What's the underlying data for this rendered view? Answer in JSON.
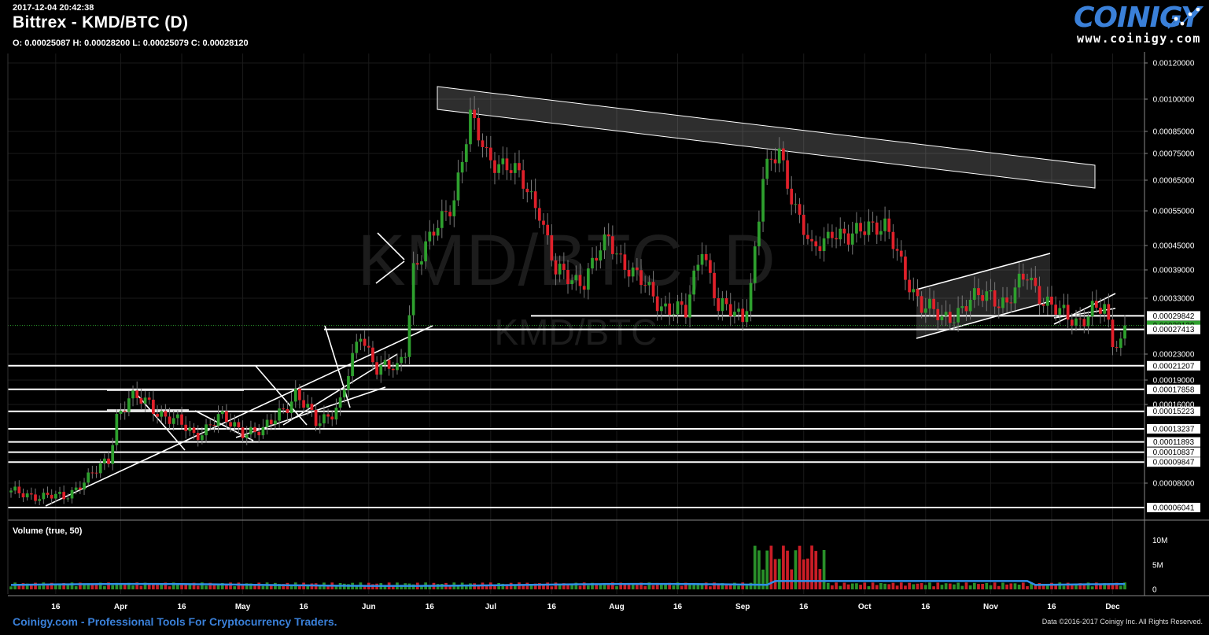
{
  "header": {
    "timestamp": "2017-12-04 20:42:38",
    "title": "Bittrex - KMD/BTC (D)",
    "ohlc": "O: 0.00025087 H: 0.00028200 L: 0.00025079 C: 0.00028120"
  },
  "logo": {
    "word": "COINIGY",
    "url": "www.coinigy.com"
  },
  "watermark": {
    "big": "KMD/BTC, D",
    "small": "KMD/BTC"
  },
  "footer": {
    "left": "Coinigy.com - Professional Tools For Cryptocurrency Traders.",
    "right": "Data ©2016-2017 Coinigy Inc. All Rights Reserved."
  },
  "colors": {
    "up": "#2ea02e",
    "down": "#e0202a",
    "volume_ma": "#2f8fe8",
    "accent": "#3a80d9",
    "last_price_bg": "#2ea02e"
  },
  "chart_data": {
    "type": "candlestick",
    "exchange": "Bittrex",
    "pair": "KMD/BTC",
    "timeframe": "D",
    "price_axis_ticks": [
      "0.00120000",
      "0.00100000",
      "0.00085000",
      "0.00075000",
      "0.00065000",
      "0.00055000",
      "0.00045000",
      "0.00039000",
      "0.00033000",
      "0.00029842",
      "0.00028120",
      "0.00027413",
      "0.00023000",
      "0.00021207",
      "0.00019000",
      "0.00017858",
      "0.00016000",
      "0.00015223",
      "0.00013237",
      "0.00011893",
      "0.00010837",
      "0.00009847",
      "0.00008000",
      "0.00006041"
    ],
    "last_price": "0.00028120",
    "horizontal_levels": [
      0.00029842,
      0.00027413,
      0.00021207,
      0.00017858,
      0.00015223,
      0.00013237,
      0.00011893,
      0.00010837,
      9.847e-05,
      6.041e-05
    ],
    "x_ticks": [
      "16",
      "Apr",
      "16",
      "May",
      "16",
      "Jun",
      "16",
      "Jul",
      "16",
      "Aug",
      "16",
      "Sep",
      "16",
      "Oct",
      "16",
      "Nov",
      "16",
      "Dec"
    ],
    "x_tick_dates": [
      "2017-03-16",
      "2017-04-01",
      "2017-04-16",
      "2017-05-01",
      "2017-05-16",
      "2017-06-01",
      "2017-06-16",
      "2017-07-01",
      "2017-07-16",
      "2017-08-01",
      "2017-08-16",
      "2017-09-01",
      "2017-09-16",
      "2017-10-01",
      "2017-10-16",
      "2017-11-01",
      "2017-11-16",
      "2017-12-01"
    ],
    "start_date": "2017-03-05",
    "end_date": "2017-12-04",
    "series_keypoints": [
      [
        "2017-03-05",
        7.2e-05
      ],
      [
        "2017-03-12",
        7e-05
      ],
      [
        "2017-03-18",
        6.8e-05
      ],
      [
        "2017-03-22",
        8e-05
      ],
      [
        "2017-03-26",
        9e-05
      ],
      [
        "2017-03-29",
        0.0001
      ],
      [
        "2017-03-31",
        0.000148
      ],
      [
        "2017-04-03",
        0.000168
      ],
      [
        "2017-04-08",
        0.00016
      ],
      [
        "2017-04-14",
        0.000142
      ],
      [
        "2017-04-19",
        0.000126
      ],
      [
        "2017-04-25",
        0.000144
      ],
      [
        "2017-05-01",
        0.000132
      ],
      [
        "2017-05-06",
        0.000128
      ],
      [
        "2017-05-10",
        0.000152
      ],
      [
        "2017-05-14",
        0.000172
      ],
      [
        "2017-05-19",
        0.00014
      ],
      [
        "2017-05-25",
        0.00016
      ],
      [
        "2017-05-30",
        0.00027
      ],
      [
        "2017-06-03",
        0.00021
      ],
      [
        "2017-06-08",
        0.000205
      ],
      [
        "2017-06-10",
        0.00024
      ],
      [
        "2017-06-12",
        0.0004
      ],
      [
        "2017-06-16",
        0.00046
      ],
      [
        "2017-06-22",
        0.0006
      ],
      [
        "2017-06-26",
        0.0009
      ],
      [
        "2017-06-30",
        0.00075
      ],
      [
        "2017-07-05",
        0.0007
      ],
      [
        "2017-07-09",
        0.00064
      ],
      [
        "2017-07-13",
        0.00056
      ],
      [
        "2017-07-17",
        0.00038
      ],
      [
        "2017-07-24",
        0.00037
      ],
      [
        "2017-07-30",
        0.00047
      ],
      [
        "2017-08-05",
        0.00038
      ],
      [
        "2017-08-12",
        0.00032
      ],
      [
        "2017-08-18",
        0.0003
      ],
      [
        "2017-08-22",
        0.00046
      ],
      [
        "2017-08-26",
        0.00031
      ],
      [
        "2017-09-01",
        0.0003
      ],
      [
        "2017-09-03",
        0.00036
      ],
      [
        "2017-09-06",
        0.00065
      ],
      [
        "2017-09-10",
        0.00077
      ],
      [
        "2017-09-14",
        0.00056
      ],
      [
        "2017-09-18",
        0.00043
      ],
      [
        "2017-09-23",
        0.0005
      ],
      [
        "2017-09-27",
        0.00046
      ],
      [
        "2017-10-02",
        0.00052
      ],
      [
        "2017-10-06",
        0.0005
      ],
      [
        "2017-10-11",
        0.00038
      ],
      [
        "2017-10-15",
        0.00032
      ],
      [
        "2017-10-20",
        0.00029
      ],
      [
        "2017-10-26",
        0.00032
      ],
      [
        "2017-11-01",
        0.00034
      ],
      [
        "2017-11-05",
        0.00032
      ],
      [
        "2017-11-10",
        0.00038
      ],
      [
        "2017-11-14",
        0.00033
      ],
      [
        "2017-11-18",
        0.0003
      ],
      [
        "2017-11-22",
        0.00029
      ],
      [
        "2017-11-26",
        0.00031
      ],
      [
        "2017-11-29",
        0.000305
      ],
      [
        "2017-12-01",
        0.00025
      ],
      [
        "2017-12-03",
        0.000255
      ],
      [
        "2017-12-04",
        0.0002812
      ]
    ],
    "volume_panel": {
      "label": "Volume (true, 50)",
      "axis_ticks": [
        "10M",
        "5M",
        "0"
      ],
      "max": 12000000
    }
  }
}
